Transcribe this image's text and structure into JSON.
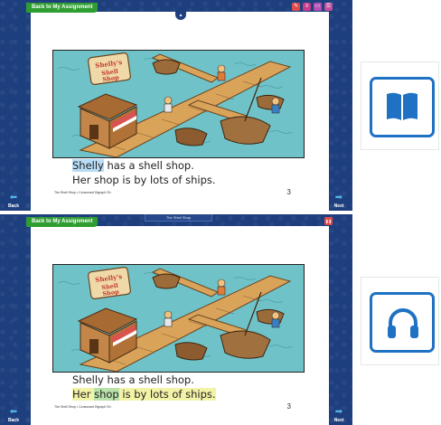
{
  "panels": [
    {
      "back_to_assignment": "Back to My Assignment",
      "tab_title": "",
      "handle_glyph": "▲",
      "tool_icons": [
        {
          "name": "pen-icon",
          "glyph": "✎",
          "color": "#e04b4b"
        },
        {
          "name": "notes-icon",
          "glyph": "≡",
          "color": "#c63b8b"
        },
        {
          "name": "comment-icon",
          "glyph": "▭",
          "color": "#b14fb3"
        },
        {
          "name": "menu-icon",
          "glyph": "☰",
          "color": "#c44f9f"
        }
      ],
      "story": {
        "highlight_word": "Shelly",
        "line1_rest": " has a shell shop.",
        "line2": "Her shop is by lots of ships."
      },
      "footer": "The Shell Shop • Consonant Digraph Sh",
      "page_number": "3",
      "nav_back": "Back",
      "nav_next": "Next"
    },
    {
      "back_to_assignment": "Back to My Assignment",
      "tab_title": "The Shell Shop",
      "handle_glyph": "",
      "tool_icons": [
        {
          "name": "pause-icon",
          "glyph": "❚❚",
          "color": "#e04b4b"
        }
      ],
      "story": {
        "line1": "Shelly has a shell shop.",
        "line2_before": "Her ",
        "line2_highlight": "shop",
        "line2_after": " is by lots of ships."
      },
      "footer": "The Shell Shop • Consonant Digraph Sh",
      "page_number": "3",
      "nav_back": "Back",
      "nav_next": "Next"
    }
  ],
  "illustration": {
    "sign_text": "Shelly's Shell Shop",
    "water_color": "#6fc3c8",
    "dock_color": "#d9a35a"
  },
  "mode_cards": [
    {
      "name": "read-mode",
      "icon": "book-icon",
      "color": "#1f72c3"
    },
    {
      "name": "listen-mode",
      "icon": "headphones-icon",
      "color": "#1f72c3"
    }
  ]
}
